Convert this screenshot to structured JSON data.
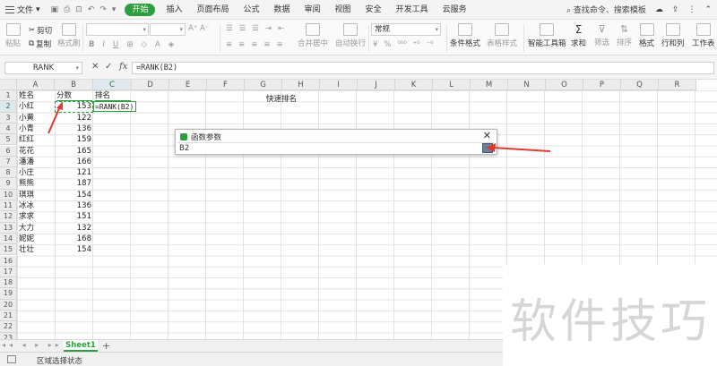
{
  "menubar": {
    "file": "文件",
    "items": [
      "开始",
      "插入",
      "页面布局",
      "公式",
      "数据",
      "审阅",
      "视图",
      "安全",
      "开发工具",
      "云服务"
    ],
    "active": "开始",
    "search": "查找命令、搜索模板"
  },
  "ribbon": {
    "paste": "粘贴",
    "cut": "剪切",
    "copy": "复制",
    "format_painter": "格式刷",
    "font_name": "",
    "font_size": "",
    "merge_center": "合并居中",
    "wrap_text": "自动换行",
    "number_format": "常规",
    "conditional_format": "条件格式",
    "table_style": "表格样式",
    "smart_toolbox": "智能工具箱",
    "sum": "求和",
    "filter": "筛选",
    "sort": "排序",
    "format": "格式",
    "row_col": "行和列",
    "worksheet": "工作表"
  },
  "formula_bar": {
    "name_box": "RANK",
    "cancel": "✕",
    "confirm": "✓",
    "fx": "fx",
    "formula": "=RANK(B2)"
  },
  "columns": [
    "A",
    "B",
    "C",
    "D",
    "E",
    "F",
    "G",
    "H",
    "I",
    "J",
    "K",
    "L",
    "M",
    "N",
    "O",
    "P",
    "Q",
    "R"
  ],
  "rows": [
    "1",
    "2",
    "3",
    "4",
    "5",
    "6",
    "7",
    "8",
    "9",
    "10",
    "11",
    "12",
    "13",
    "14",
    "15",
    "16",
    "17",
    "18",
    "19",
    "20",
    "21",
    "22",
    "23"
  ],
  "table": {
    "headers": [
      "姓名",
      "分数",
      "排名"
    ],
    "names": [
      "小红",
      "小黄",
      "小青",
      "红红",
      "花花",
      "潘潘",
      "小庄",
      "熊熊",
      "琪琪",
      "冰冰",
      "求求",
      "大力",
      "妮妮",
      "壮壮"
    ],
    "scores": [
      "153",
      "122",
      "136",
      "159",
      "165",
      "166",
      "121",
      "187",
      "154",
      "136",
      "151",
      "132",
      "168",
      "154"
    ],
    "c2": "=RANK(B2)"
  },
  "title_cell": "快速排名",
  "dialog": {
    "title": "函数参数",
    "close": "✕",
    "value": "B2"
  },
  "tabs": {
    "sheet": "Sheet1",
    "add": "+"
  },
  "status": {
    "text": "区域选择状态"
  },
  "watermark": "软件技巧",
  "colors": {
    "accent": "#2e9f3f",
    "arrow": "#e03a2e"
  }
}
